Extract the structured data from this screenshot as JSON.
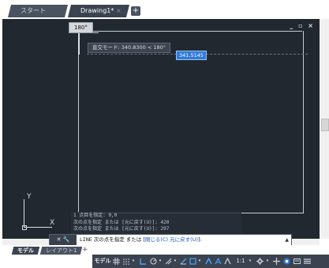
{
  "tabs": [
    {
      "label": "スタート"
    },
    {
      "label": "Drawing1*",
      "close": "×"
    }
  ],
  "add_tab": "+",
  "window_controls": "_ ▫ ×",
  "canvas": {
    "angle_tooltip": "180°",
    "polar_tooltip": "直交モード: 340.8300 < 180°",
    "dynamic_input": "341.5145",
    "ucs_x": "X",
    "ucs_y": "Y"
  },
  "history": [
    "1 点目を指定: 0,0",
    "次の点を指定 または [元に戻す(U)]: 420",
    "次の点を指定 または [元に戻す(U)]: 297"
  ],
  "command": {
    "tools": "✕ 🔧",
    "prefix": "LINE",
    "prompt": "次の点を指定 または [",
    "option1": "閉じる(C)",
    "option2": "元に戻す(U)",
    "suffix": "]:",
    "up_arrow": "▲"
  },
  "layout_tabs": [
    {
      "label": "モデル"
    },
    {
      "label": "レイアウト1"
    }
  ],
  "layout_add": "+",
  "status": {
    "model": "モデル",
    "scale": "1:1",
    "colors": {
      "accent": "#2f7bd8",
      "bar": "#3b4350"
    }
  }
}
